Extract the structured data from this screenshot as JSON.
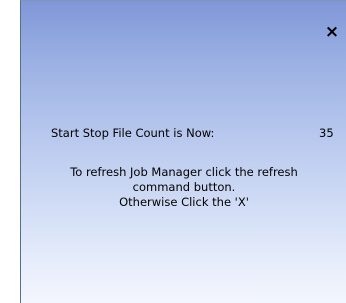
{
  "close_glyph": "×",
  "status": {
    "count_label": "Start Stop File Count is Now:",
    "count_value": "35"
  },
  "message": {
    "line1": "To refresh Job Manager click the refresh",
    "line2": "command button.",
    "line3": "Otherwise Click the 'X'"
  },
  "colors": {
    "gradient_top": "#7f97d8",
    "gradient_bottom": "#f3f6fd",
    "text": "#000000"
  }
}
